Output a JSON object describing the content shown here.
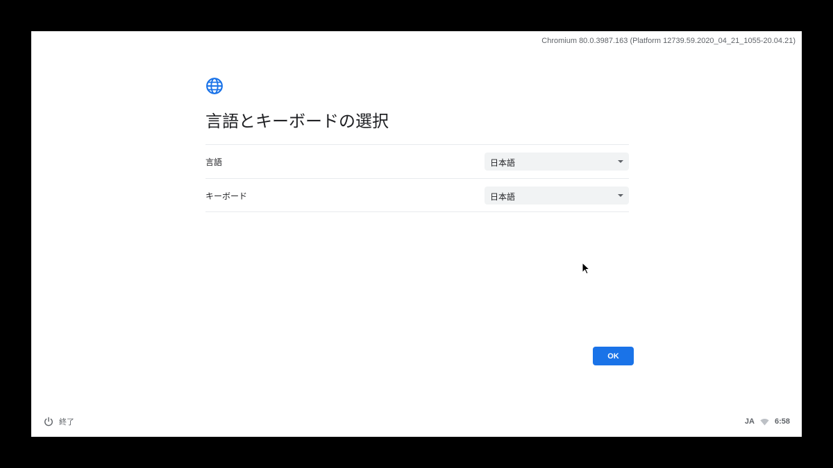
{
  "version_text": "Chromium 80.0.3987.163 (Platform 12739.59.2020_04_21_1055-20.04.21)",
  "header": {
    "icon": "globe-icon",
    "title": "言語とキーボードの選択"
  },
  "settings": {
    "language": {
      "label": "言語",
      "value": "日本語"
    },
    "keyboard": {
      "label": "キーボード",
      "value": "日本語"
    }
  },
  "ok_button": {
    "label": "OK"
  },
  "shelf": {
    "shutdown_icon": "power-icon",
    "shutdown_label": "終了",
    "ime": "JA",
    "wifi_icon": "wifi-icon",
    "time": "6:58"
  },
  "colors": {
    "accent": "#1a73e8",
    "background": "#ffffff",
    "select_background": "#f1f3f4",
    "secondary_text": "#5f6368"
  }
}
